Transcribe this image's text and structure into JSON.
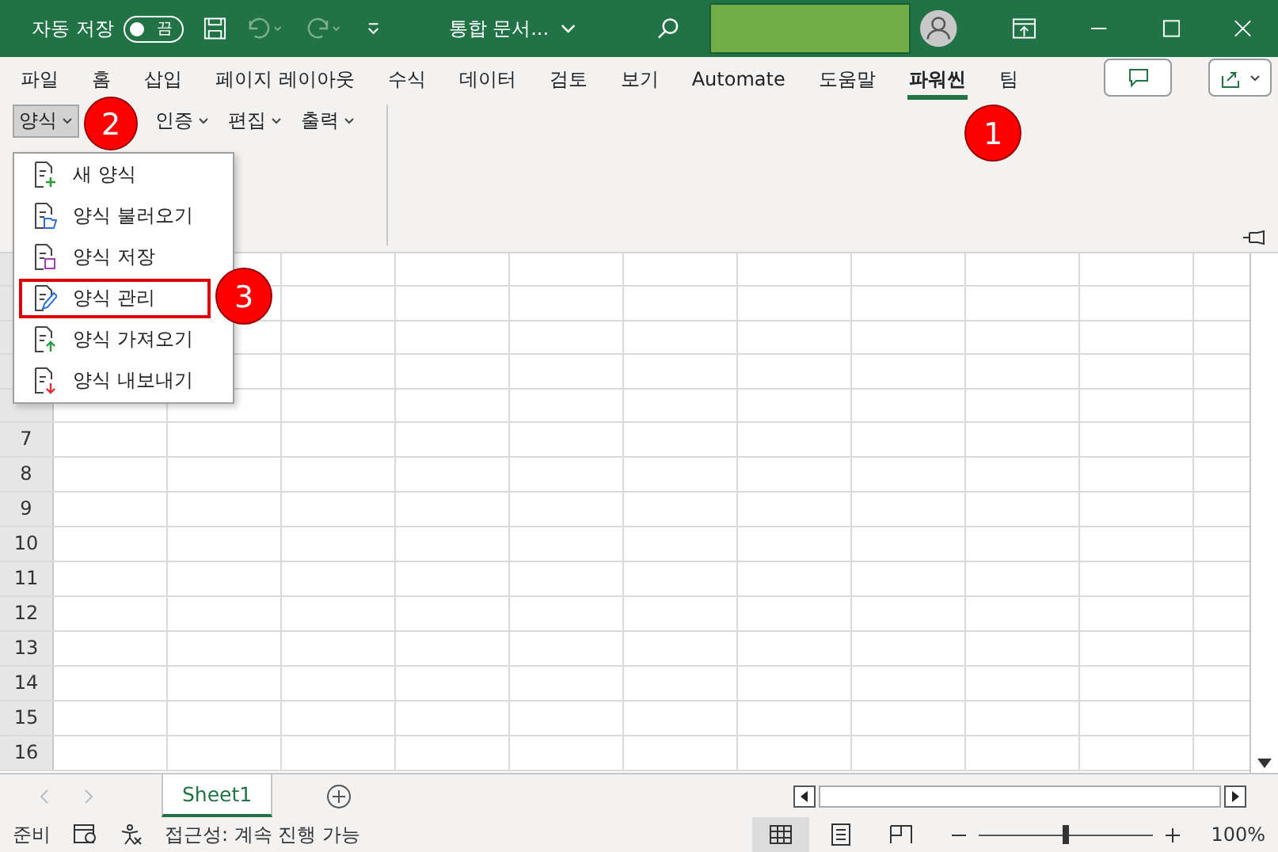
{
  "title_bar": {
    "autosave_label": "자동 저장",
    "autosave_toggle": {
      "label": "끔",
      "on": false
    },
    "document_title": "통합 문서..."
  },
  "ribbon_tabs": [
    {
      "label": "파일",
      "selected": false
    },
    {
      "label": "홈",
      "selected": false
    },
    {
      "label": "삽입",
      "selected": false
    },
    {
      "label": "페이지 레이아웃",
      "selected": false
    },
    {
      "label": "수식",
      "selected": false
    },
    {
      "label": "데이터",
      "selected": false
    },
    {
      "label": "검토",
      "selected": false
    },
    {
      "label": "보기",
      "selected": false
    },
    {
      "label": "Automate",
      "selected": false
    },
    {
      "label": "도움말",
      "selected": false
    },
    {
      "label": "파워씬",
      "selected": true
    },
    {
      "label": "팀",
      "selected": false
    }
  ],
  "ribbon_groups": [
    {
      "label": "양식",
      "selected": true
    },
    {
      "label": "인증",
      "selected": false
    },
    {
      "label": "편집",
      "selected": false
    },
    {
      "label": "출력",
      "selected": false
    }
  ],
  "dropdown_menu": [
    {
      "label": "새 양식",
      "kind": "new",
      "highlighted": false
    },
    {
      "label": "양식 불러오기",
      "kind": "open",
      "highlighted": false
    },
    {
      "label": "양식 저장",
      "kind": "save",
      "highlighted": false
    },
    {
      "label": "양식 관리",
      "kind": "manage",
      "highlighted": true
    },
    {
      "label": "양식 가져오기",
      "kind": "import",
      "highlighted": false
    },
    {
      "label": "양식 내보내기",
      "kind": "export",
      "highlighted": false
    }
  ],
  "callouts": [
    "1",
    "2",
    "3"
  ],
  "row_headers": [
    "7",
    "8",
    "9",
    "10",
    "11",
    "12",
    "13",
    "14",
    "15",
    "16"
  ],
  "sheet_tabs": [
    {
      "label": "Sheet1",
      "selected": true
    }
  ],
  "status_bar": {
    "ready": "준비",
    "accessibility": "접근성: 계속 진행 가능",
    "zoom": "100%",
    "zoom_slider": {
      "level": 0.5
    }
  }
}
